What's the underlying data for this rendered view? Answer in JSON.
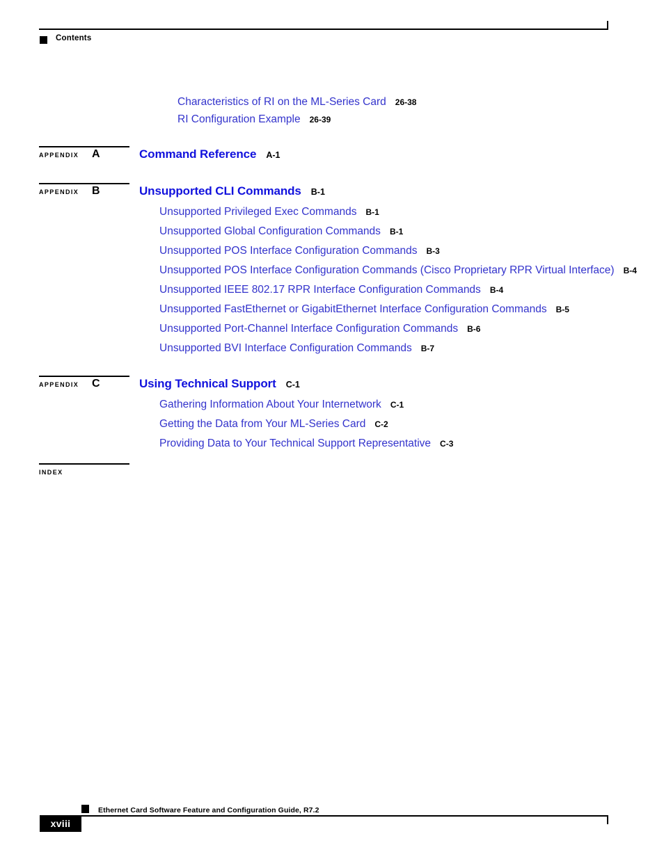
{
  "header": {
    "title": "Contents",
    "bullet_icon": "square-bullet-icon"
  },
  "toc": {
    "top_entries": [
      {
        "label": "Characteristics of RI on the ML-Series Card",
        "page": "26-38"
      },
      {
        "label": "RI Configuration Example",
        "page": "26-39"
      }
    ],
    "sections": [
      {
        "marker_word": "Appendix",
        "marker_letter": "A",
        "heading": "Command Reference",
        "heading_page": "A-1",
        "children": []
      },
      {
        "marker_word": "Appendix",
        "marker_letter": "B",
        "heading": "Unsupported CLI Commands",
        "heading_page": "B-1",
        "children": [
          {
            "label": "Unsupported Privileged Exec Commands",
            "page": "B-1"
          },
          {
            "label": "Unsupported Global Configuration Commands",
            "page": "B-1"
          },
          {
            "label": "Unsupported POS Interface Configuration Commands",
            "page": "B-3"
          },
          {
            "label": "Unsupported POS Interface Configuration Commands (Cisco Proprietary RPR Virtual Interface)",
            "page": "B-4"
          },
          {
            "label": "Unsupported IEEE 802.17 RPR Interface Configuration Commands",
            "page": "B-4"
          },
          {
            "label": "Unsupported FastEthernet or GigabitEthernet Interface Configuration Commands",
            "page": "B-5"
          },
          {
            "label": "Unsupported Port-Channel Interface Configuration Commands",
            "page": "B-6"
          },
          {
            "label": "Unsupported BVI Interface Configuration Commands",
            "page": "B-7"
          }
        ]
      },
      {
        "marker_word": "Appendix",
        "marker_letter": "C",
        "heading": "Using Technical Support",
        "heading_page": "C-1",
        "children": [
          {
            "label": "Gathering Information About Your Internetwork",
            "page": "C-1"
          },
          {
            "label": "Getting the Data from Your ML-Series Card",
            "page": "C-2"
          },
          {
            "label": "Providing Data to Your Technical Support Representative",
            "page": "C-3"
          }
        ]
      }
    ],
    "index_marker": {
      "marker_word": "Index"
    }
  },
  "footer": {
    "guide_title": "Ethernet Card Software Feature and Configuration Guide, R7.2",
    "page_number": "xviii",
    "bullet_icon": "square-bullet-icon"
  },
  "colors": {
    "link_blue": "#3333CC",
    "heading_blue": "#1111DD",
    "rule_black": "#000000"
  }
}
